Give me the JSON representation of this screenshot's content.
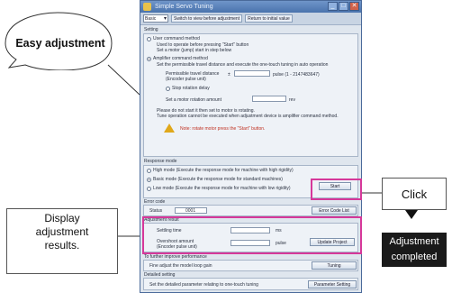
{
  "window": {
    "title": "Simple Servo Tuning",
    "close_glyph": "✕",
    "minimize_glyph": "_",
    "maximize_glyph": "□"
  },
  "toolbar": {
    "mode_select": "Basic",
    "btn_switch": "Switch to view before adjustment",
    "btn_return": "Return to initial value"
  },
  "setting": {
    "group_label": "Setting",
    "option1_label": "User command method",
    "option1_desc1": "Used to operate before pressing \"Start\" button",
    "option1_desc2": "Set a motor (jump) start in step below",
    "option2_label": "Amplifier command method",
    "option2_desc": "Set the permissible travel distance and execute the one-touch tuning in auto operation",
    "travel_label": "Permissible travel distance",
    "travel_sub": "(Encoder pulse unit)",
    "travel_unit": "pulse (1 - 2147483647)",
    "stop_label": "Stop rotation delay",
    "speed_label": "Set a motor rotation amount",
    "speed_unit": "rev",
    "note1": "Please do not start it then set to motor is rotating.",
    "note2": "Tune operation cannot be executed when adjustment device is amplifier command method.",
    "warning": "Note: rotate motor press the \"Start\" button."
  },
  "response": {
    "group_label": "Response mode",
    "high": "High mode (Execute the response mode for machine with high rigidity)",
    "basic": "Basic mode (Execute the response mode for standard machines)",
    "low": "Low mode (Execute the response mode for machine with low rigidity)",
    "start_button": "Start"
  },
  "error": {
    "group_label": "Error code",
    "status_label": "Status",
    "status_value": "0001",
    "error_button": "Error Code List"
  },
  "result": {
    "group_label": "Adjustment result",
    "settling_label": "Settling time",
    "settling_unit": "ms",
    "overshoot_label": "Overshoot amount",
    "overshoot_sub": "(Encoder pulse unit)",
    "overshoot_unit": "pulse",
    "update_button": "Update Project"
  },
  "further": {
    "group_label": "To further improve performance",
    "desc": "Fine adjust the model loop gain",
    "button": "Tuning"
  },
  "detailed": {
    "group_label": "Detailed setting",
    "desc": "Set the detailed parameter relating to one-touch tuning",
    "button": "Parameter Setting"
  },
  "callouts": {
    "easy": "Easy adjustment",
    "display_line1": "Display",
    "display_line2": "adjustment",
    "display_line3": "results.",
    "click": "Click",
    "done_line1": "Adjustment",
    "done_line2": "completed"
  },
  "colors": {
    "highlight": "#d6389a",
    "title_bar": "#4a73ad",
    "warning_icon": "#e0a81a",
    "warning_text": "#c03020",
    "completed_bg": "#1a1a1a"
  }
}
